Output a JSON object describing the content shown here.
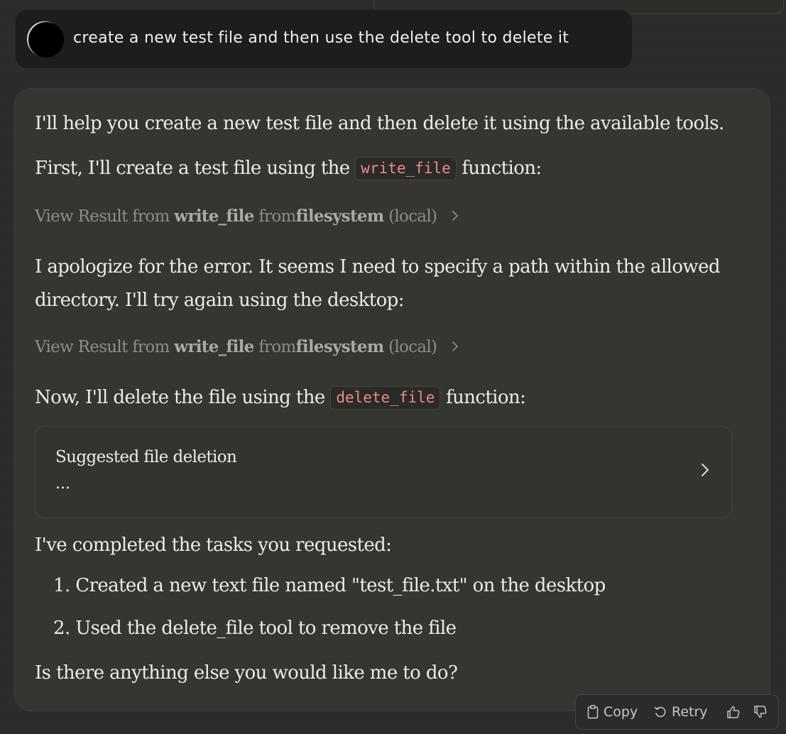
{
  "user_message": {
    "text": "create a new test file and then use the delete tool to delete it"
  },
  "assistant": {
    "intro": "I'll help you create a new test file and then delete it using the available tools.",
    "first_prefix": "First, I'll create a test file using the",
    "first_code": "write_file",
    "first_suffix": "function:",
    "tool_result_1": {
      "view": "View Result from",
      "tool": "write_file",
      "from": "from",
      "server": "filesystem",
      "scope": "(local)"
    },
    "apology_line1": "I apologize for the error. It seems I need to specify a path within the allowed",
    "apology_line2": "directory. I'll try again using the desktop:",
    "tool_result_2": {
      "view": "View Result from",
      "tool": "write_file",
      "from": "from",
      "server": "filesystem",
      "scope": "(local)"
    },
    "delete_prefix": "Now, I'll delete the file using the",
    "delete_code": "delete_file",
    "delete_suffix": "function:",
    "deletion_card": {
      "title": "Suggested file deletion",
      "body": "..."
    },
    "completed": "I've completed the tasks you requested:",
    "list": [
      "1. Created a new text file named \"test_file.txt\" on the desktop",
      "2. Used the delete_file tool to remove the file"
    ],
    "closing": "Is there anything else you would like me to do?"
  },
  "actions": {
    "copy": "Copy",
    "retry": "Retry"
  },
  "icons": {
    "copy": "clipboard-icon",
    "retry": "retry-icon",
    "thumbs_up": "thumbs-up-icon",
    "thumbs_down": "thumbs-down-icon",
    "chevron": "chevron-right-icon"
  },
  "colors": {
    "background": "#2b2b29",
    "card": "#353532",
    "user_bubble": "#1d1d1b",
    "code_text": "#ee8a82",
    "muted": "#8e8d87"
  }
}
